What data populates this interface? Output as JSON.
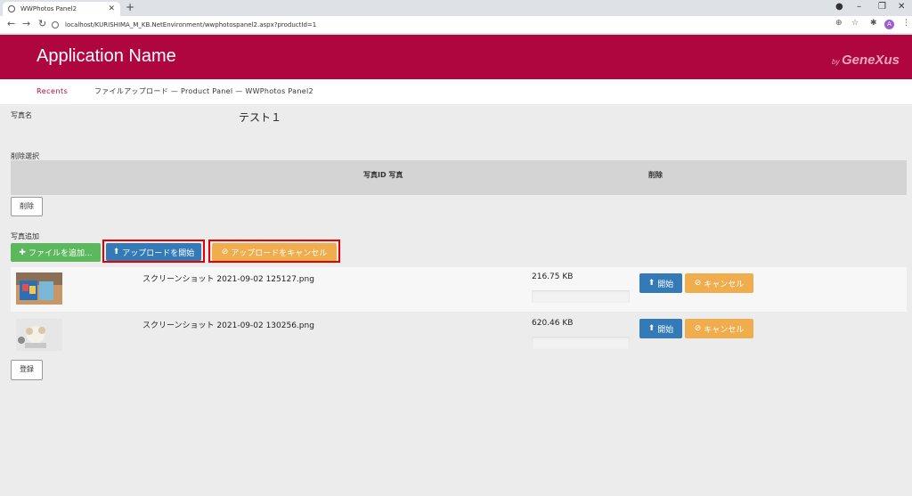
{
  "browser": {
    "tab_title": "WWPhotos Panel2",
    "url": "localhost/KURISHIMA_M_KB.NetEnvironment/wwphotospanel2.aspx?productId=1",
    "profile_initial": "A"
  },
  "header": {
    "app_name": "Application Name",
    "brand_by": "by",
    "brand_name": "GeneXus"
  },
  "breadcrumb": {
    "recents": "Recents",
    "trail": "ファイルアップロード — Product Panel — WWPhotos Panel2"
  },
  "form": {
    "photo_name_label": "写真名",
    "photo_name_value": "テスト１",
    "delete_selection_label": "削除選択",
    "grid_columns": [
      "写真ID 写真",
      "削除"
    ],
    "delete_button": "削除",
    "add_photo_label": "写真追加",
    "register_button": "登録"
  },
  "upload_toolbar": {
    "add_files": "ファイルを追加...",
    "start_upload": "アップロードを開始",
    "cancel_upload": "アップロードをキャンセル"
  },
  "files": [
    {
      "name": "スクリーンショット 2021-09-02 125127.png",
      "size": "216.75 KB",
      "progress": 0,
      "start": "開始",
      "cancel": "キャンセル"
    },
    {
      "name": "スクリーンショット 2021-09-02 130256.png",
      "size": "620.46 KB",
      "progress": 0,
      "start": "開始",
      "cancel": "キャンセル"
    }
  ],
  "colors": {
    "brand": "#b0063f",
    "primary": "#337ab7",
    "success": "#5cb85c",
    "warning": "#f0ad4e",
    "highlight": "#e40000"
  }
}
